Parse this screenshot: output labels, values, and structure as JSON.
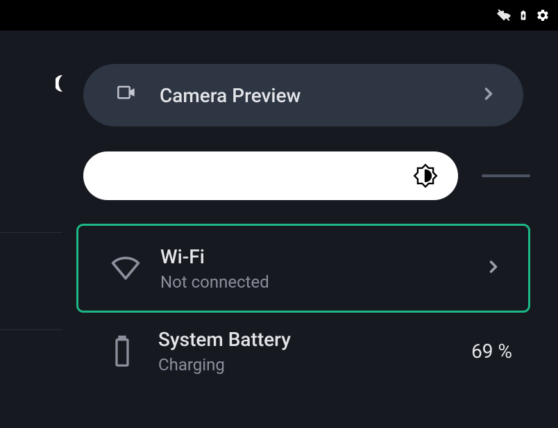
{
  "camera": {
    "label": "Camera Preview"
  },
  "wifi": {
    "title": "Wi-Fi",
    "subtitle": "Not connected"
  },
  "battery": {
    "title": "System Battery",
    "subtitle": "Charging",
    "percent": "69 %"
  }
}
